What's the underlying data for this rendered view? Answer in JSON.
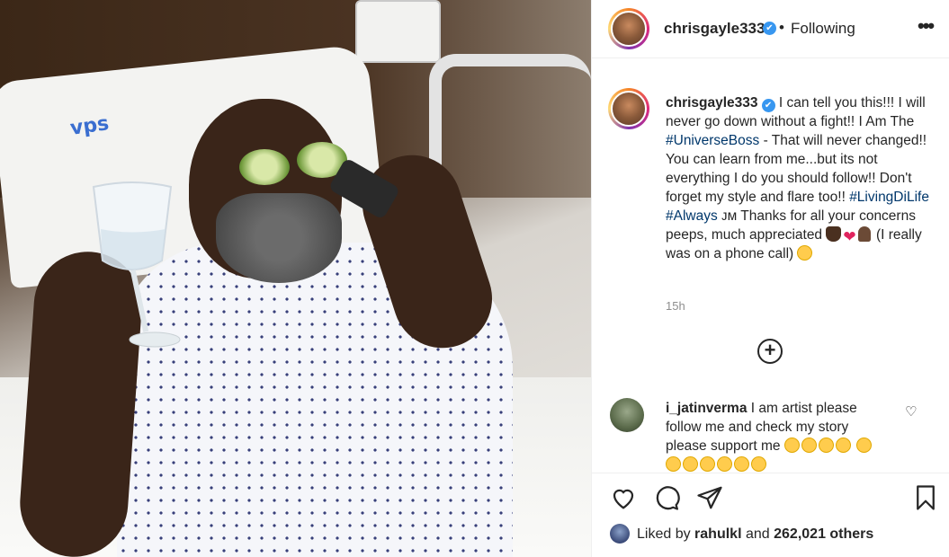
{
  "post": {
    "username": "chrisgayle333",
    "verified_mark": "✔",
    "separator": "•",
    "follow_status": "Following",
    "more_label": "•••"
  },
  "photo": {
    "pillow_logo": "vps"
  },
  "caption": {
    "username": "chrisgayle333",
    "part1": "I can tell you this!!! I will never go down without a fight!! I Am The",
    "hashtag1": "#UniverseBoss",
    "part2": "- That will never changed!! You can learn from me...but its not everything I do you should follow!! Don't forget my style and flare too!!",
    "hashtag2": "#LivingDiLife",
    "hashtag3": "#Always",
    "mark": "ᴊᴍ",
    "part3": "Thanks for all your concerns peeps, much appreciated",
    "heart": "❤",
    "part4": "(I really was on a phone call)",
    "timestamp": "15h",
    "add_label": "+"
  },
  "comment": {
    "username": "i_jatinverma",
    "text": "I am artist please follow me and check my story please support me",
    "heart": "♡"
  },
  "actions": {
    "liked_prefix": "Liked by",
    "liked_user": "rahulkl",
    "liked_mid": "and",
    "liked_count": "262,021 others"
  },
  "icons": [
    "heart-icon",
    "comment-icon",
    "share-icon",
    "bookmark-icon",
    "more-icon",
    "add-comment-icon"
  ]
}
